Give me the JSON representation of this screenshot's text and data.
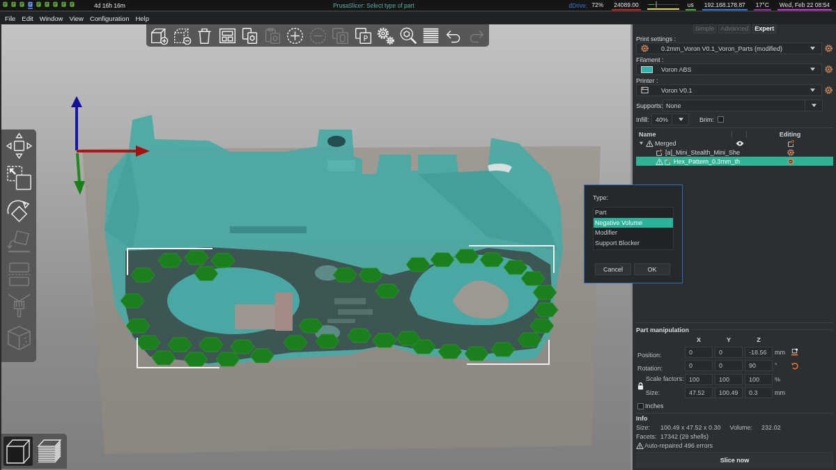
{
  "system_bar": {
    "workspaces": [
      {
        "selected": false
      },
      {
        "selected": false
      },
      {
        "selected": false
      },
      {
        "selected": true
      },
      {
        "selected": false
      },
      {
        "selected": false
      },
      {
        "selected": false
      },
      {
        "selected": false
      },
      {
        "selected": false
      }
    ],
    "uptime": "4d 16h 16m",
    "title": "PrusaSlicer: Select type of part",
    "widgets": [
      {
        "kind": "text",
        "label": "dDrive:",
        "text": "72%"
      },
      {
        "kind": "text",
        "text": "24089.00",
        "color": "#c81e1e"
      },
      {
        "kind": "graph",
        "color": "#e6dc50"
      },
      {
        "kind": "text",
        "text": "us",
        "color": "#3cb43c"
      },
      {
        "kind": "text",
        "text": "192.168.178.87",
        "color": "#2878e6"
      },
      {
        "kind": "text",
        "text": "17°C",
        "color": "#9a28a8"
      },
      {
        "kind": "text",
        "text": "Wed, Feb 22 08:54",
        "color": "#c832dc"
      }
    ]
  },
  "menu": [
    "File",
    "Edit",
    "Window",
    "View",
    "Configuration",
    "Help"
  ],
  "top_toolbar": [
    {
      "kind": "add",
      "disabled": false
    },
    {
      "kind": "delete",
      "disabled": false
    },
    {
      "kind": "delete_all",
      "disabled": false
    },
    {
      "kind": "arrange",
      "disabled": false
    },
    {
      "kind": "copy",
      "disabled": false
    },
    {
      "kind": "paste",
      "disabled": true
    },
    {
      "kind": "add_instance",
      "disabled": false
    },
    {
      "kind": "remove_instance",
      "disabled": true
    },
    {
      "kind": "split_objects",
      "disabled": true
    },
    {
      "kind": "split_parts",
      "disabled": false,
      "glyph": "P"
    },
    {
      "kind": "settings",
      "disabled": false
    },
    {
      "kind": "search",
      "disabled": false
    },
    {
      "kind": "layers",
      "disabled": false
    },
    {
      "kind": "undo",
      "disabled": false
    },
    {
      "kind": "redo",
      "disabled": true
    }
  ],
  "left_toolbar": [
    {
      "kind": "move",
      "disabled": false
    },
    {
      "kind": "scale",
      "disabled": false
    },
    {
      "kind": "rotate",
      "disabled": false
    },
    {
      "kind": "place_on_face",
      "disabled": true
    },
    {
      "kind": "cut",
      "disabled": true
    },
    {
      "kind": "paint",
      "disabled": true
    },
    {
      "kind": "seam",
      "disabled": true
    }
  ],
  "view_toggle": [
    {
      "kind": "model",
      "selected": true
    },
    {
      "kind": "preview",
      "selected": false
    }
  ],
  "dialog": {
    "label": "Type:",
    "options": [
      {
        "label": "Part",
        "selected": false
      },
      {
        "label": "Negative Volume",
        "selected": true
      },
      {
        "label": "Modifier",
        "selected": false
      },
      {
        "label": "Support Blocker",
        "selected": false
      }
    ],
    "buttons": [
      "Cancel",
      "OK"
    ]
  },
  "sidebar": {
    "modes": [
      {
        "label": "Simple",
        "selected": false
      },
      {
        "label": "Advanced",
        "selected": false
      },
      {
        "label": "Expert",
        "selected": true
      }
    ],
    "presets": [
      {
        "kind": "print",
        "label": "Print settings :",
        "value": "0.2mm_Voron V0.1_Voron_Parts (modified)"
      },
      {
        "kind": "filament",
        "label": "Filament :",
        "value": "Voron ABS"
      },
      {
        "kind": "printer",
        "label": "Printer :",
        "value": "Voron V0.1"
      }
    ],
    "supports": {
      "label": "Supports:",
      "value": "None"
    },
    "infill": {
      "label": "Infill:",
      "value": "40%"
    },
    "brim": {
      "label": "Brim:",
      "checked": false
    },
    "object_list": {
      "columns": [
        "Name",
        "Editing"
      ],
      "items": [
        {
          "name": "Merged",
          "kind": "object",
          "warning": true,
          "expanded": true,
          "selected": false,
          "children": [
            {
              "name": "[a]_Mini_Stealth_Mini_She",
              "kind": "part",
              "warning": false,
              "selected": false
            },
            {
              "name": "Hex_Pattern_0.3mm_th",
              "kind": "part",
              "warning": true,
              "selected": true
            }
          ]
        }
      ]
    },
    "part_manipulation": {
      "title": "Part manipulation",
      "axes": [
        "X",
        "Y",
        "Z"
      ],
      "rows": [
        {
          "kind": "position",
          "label": "Position:",
          "values": [
            "0",
            "0",
            "-18.56"
          ],
          "unit": "mm"
        },
        {
          "kind": "rotation",
          "label": "Rotation:",
          "values": [
            "0",
            "0",
            "90"
          ],
          "unit": "°"
        },
        {
          "kind": "scale",
          "label": "Scale factors:",
          "values": [
            "100",
            "100",
            "100"
          ],
          "unit": "%"
        },
        {
          "kind": "size",
          "label": "Size:",
          "values": [
            "47.52",
            "100.49",
            "0.3"
          ],
          "unit": "mm"
        }
      ],
      "inches": {
        "label": "Inches",
        "checked": false
      }
    },
    "info": {
      "title": "Info",
      "size_label": "Size:",
      "size": "100.49 x 47.52 x 0.30",
      "volume_label": "Volume:",
      "volume": "232.02",
      "facets_label": "Facets:",
      "facets": "17342 (29 shells)",
      "warning": "Auto-repaired 496 errors"
    },
    "slice_button": "Slice now"
  }
}
